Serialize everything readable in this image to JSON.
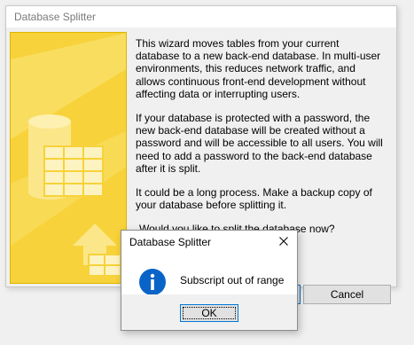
{
  "wizard": {
    "title": "Database Splitter",
    "paragraphs": [
      "This wizard moves tables from your current database to a new back-end database. In multi-user environments, this reduces network traffic, and allows continuous front-end development without affecting data or interrupting users.",
      "If your database is protected with a password, the new back-end database will be created without a password and will be accessible to all users.  You will need to add a password to the back-end database after it is split.",
      "It could be a long process. Make a backup copy of your database before splitting it.",
      "Would you like to split the database now?"
    ],
    "cancel_label": "Cancel",
    "art_colors": {
      "background": "#f7d23a",
      "accent": "#fbe78a",
      "shade": "#e9b70e"
    }
  },
  "dialog": {
    "title": "Database Splitter",
    "message": "Subscript out of range",
    "ok_label": "OK",
    "icon": "info-icon",
    "close_icon": "close-icon",
    "icon_color": "#0066cc"
  }
}
